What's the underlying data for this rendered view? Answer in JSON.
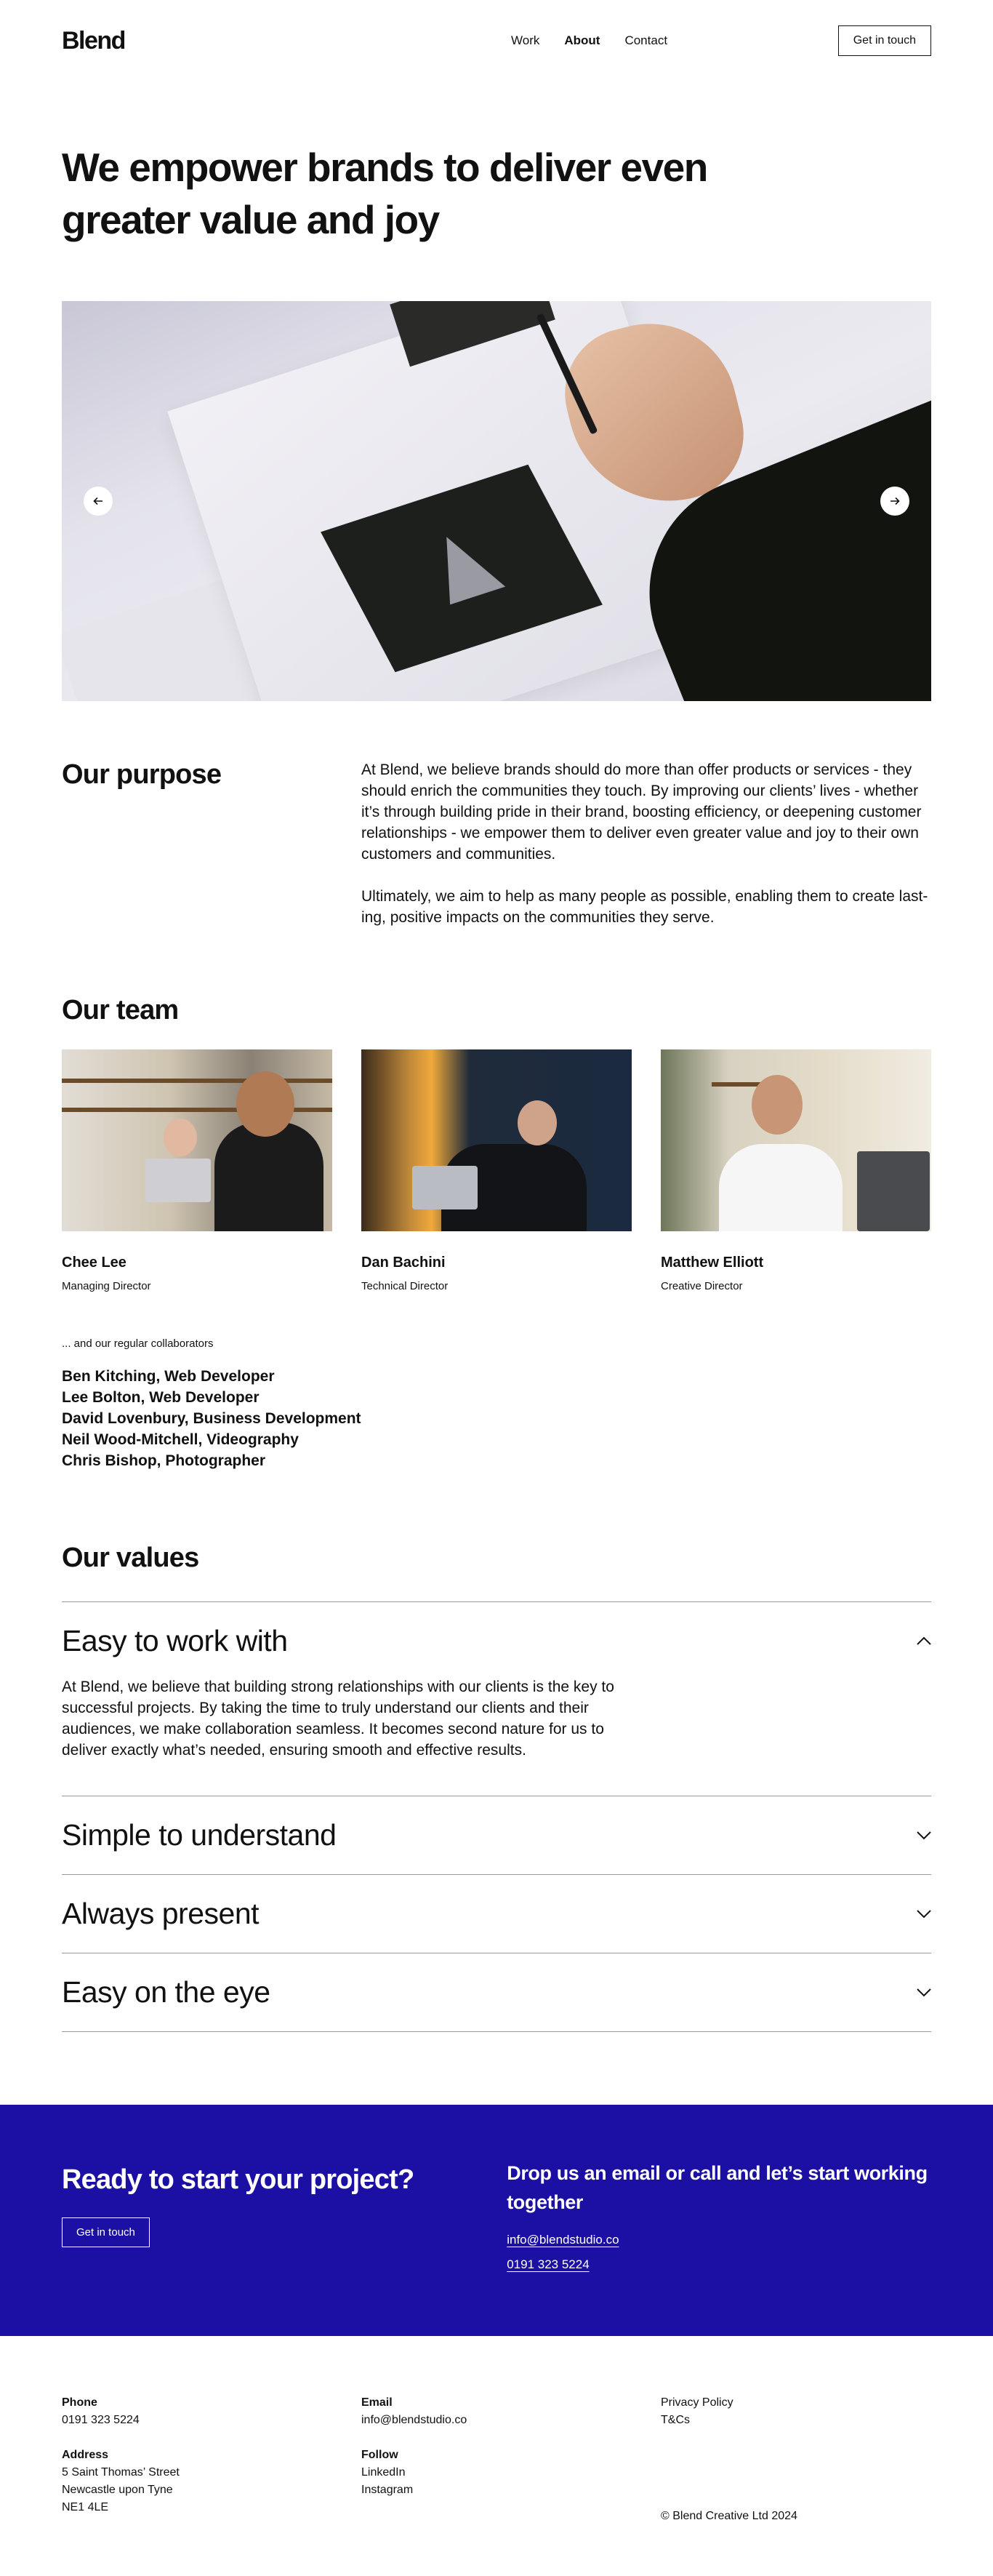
{
  "header": {
    "logo": "Blend",
    "nav": [
      "Work",
      "About",
      "Contact"
    ],
    "cta": "Get in touch"
  },
  "hero": {
    "title": "We empower brands to deliver even greater value and joy"
  },
  "carousel": {
    "prev_icon": "arrow-left-icon",
    "next_icon": "arrow-right-icon"
  },
  "purpose": {
    "title": "Our purpose",
    "paragraphs": [
      "At Blend, we believe brands should do more than offer products or services - they should enrich the communities they touch. By improving our clients’ lives - whether it’s through building pride in their brand, boosting efficiency, or deepening customer relationships - we empower them to deliver even greater value and joy to their own customers and communities.",
      "Ultimately, we aim to help as many people as possible, enabling them to create last- ing, positive impacts on the communities they serve."
    ]
  },
  "team": {
    "title": "Our team",
    "members": [
      {
        "name": "Chee Lee",
        "role": "Managing Director"
      },
      {
        "name": "Dan Bachini",
        "role": "Technical Director"
      },
      {
        "name": "Matthew Elliott",
        "role": "Creative Director"
      }
    ],
    "collab_intro": "... and our regular collaborators",
    "collaborators": [
      "Ben Kitching, Web Developer",
      "Lee Bolton, Web Developer",
      "David Lovenbury, Business Development",
      "Neil Wood-Mitchell, Videography",
      "Chris Bishop, Photographer"
    ]
  },
  "values": {
    "title": "Our values",
    "items": [
      {
        "title": "Easy to work with",
        "open": true,
        "body": "At Blend, we believe that building strong relationships with our clients is the key to successful projects. By taking the time to truly understand our clients and their audiences, we make collaboration seamless. It becomes second nature for us to deliver exactly what’s needed, ensuring smooth and effective results."
      },
      {
        "title": "Simple to understand",
        "open": false
      },
      {
        "title": "Always present",
        "open": false
      },
      {
        "title": "Easy on the eye",
        "open": false
      }
    ]
  },
  "cta": {
    "title": "Ready to start your project?",
    "button": "Get in touch",
    "right_title": "Drop us an email or call and let’s start working together",
    "email": "info@blendstudio.co",
    "phone": "0191 323 5224",
    "bg_color": "#1c0fa3"
  },
  "footer": {
    "phone_label": "Phone",
    "phone": "0191 323 5224",
    "address_label": "Address",
    "address": [
      "5 Saint Thomas’ Street",
      "Newcastle upon Tyne",
      "NE1 4LE"
    ],
    "email_label": "Email",
    "email": "info@blendstudio.co",
    "follow_label": "Follow",
    "follow": [
      "LinkedIn",
      "Instagram"
    ],
    "legal": [
      "Privacy Policy",
      "T&Cs"
    ],
    "copyright": "© Blend Creative Ltd 2024"
  }
}
